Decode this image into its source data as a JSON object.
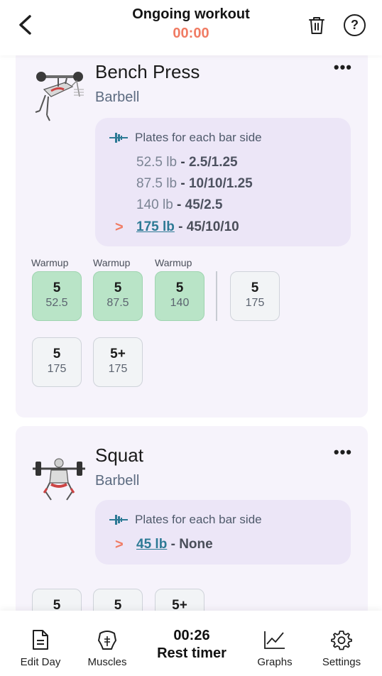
{
  "header": {
    "title": "Ongoing workout",
    "timer": "00:00"
  },
  "exercises": [
    {
      "name": "Bench Press",
      "equipment": "Barbell",
      "plates_title": "Plates for each bar side",
      "plates": [
        {
          "weight": "52.5 lb",
          "plates": "2.5/1.25"
        },
        {
          "weight": "87.5 lb",
          "plates": "10/10/1.25"
        },
        {
          "weight": "140 lb",
          "plates": "45/2.5"
        }
      ],
      "current": {
        "weight": "175 lb",
        "plates": "45/10/10"
      },
      "warmup_label": "Warmup",
      "sets": [
        {
          "reps": "5",
          "weight": "52.5",
          "warmup": true,
          "done": true
        },
        {
          "reps": "5",
          "weight": "87.5",
          "warmup": true,
          "done": true
        },
        {
          "reps": "5",
          "weight": "140",
          "warmup": true,
          "done": true
        },
        {
          "reps": "5",
          "weight": "175",
          "warmup": false,
          "done": false
        },
        {
          "reps": "5",
          "weight": "175",
          "warmup": false,
          "done": false
        },
        {
          "reps": "5+",
          "weight": "175",
          "warmup": false,
          "done": false
        }
      ]
    },
    {
      "name": "Squat",
      "equipment": "Barbell",
      "plates_title": "Plates for each bar side",
      "current": {
        "weight": "45 lb",
        "plates": "None"
      },
      "sets": [
        {
          "reps": "5"
        },
        {
          "reps": "5"
        },
        {
          "reps": "5+"
        }
      ]
    }
  ],
  "bottom_nav": {
    "edit_day": "Edit Day",
    "muscles": "Muscles",
    "rest_time": "00:26",
    "rest_label": "Rest timer",
    "graphs": "Graphs",
    "settings": "Settings"
  },
  "colors": {
    "accent": "#f07b63",
    "done_set": "#b9e4c7",
    "link": "#2d7a95"
  }
}
